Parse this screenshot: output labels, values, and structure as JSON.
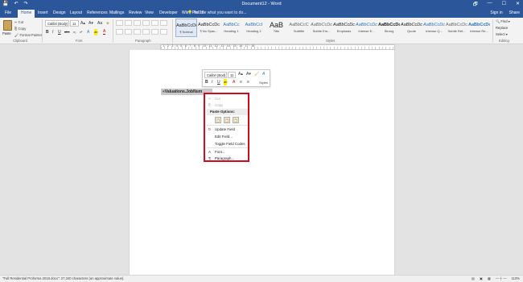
{
  "titlebar": {
    "title": "Document12 - Word",
    "qat": [
      "💾",
      "↶",
      "↷"
    ],
    "controls": [
      "🗗",
      "—",
      "☐",
      "✕"
    ]
  },
  "tabs": {
    "items": [
      "File",
      "Home",
      "Insert",
      "Design",
      "Layout",
      "References",
      "Mailings",
      "Review",
      "View",
      "Developer",
      "Wiiro Pro 10"
    ],
    "active": "Home",
    "tell_me": "💡 Tell me what you want to do...",
    "sign_in": "Sign in",
    "share": "Share"
  },
  "ribbon": {
    "clipboard": {
      "paste": "Paste",
      "cut": "✂ Cut",
      "copy": "⎘ Copy",
      "format_painter": "🖌 Format Painter",
      "label": "Clipboard"
    },
    "font": {
      "name": "Calibri (Body)",
      "size": "11",
      "label": "Font",
      "buttons": [
        "B",
        "I",
        "U",
        "abc",
        "x₂",
        "x²",
        "A",
        "ab",
        "A"
      ]
    },
    "paragraph": {
      "label": "Paragraph"
    },
    "styles": {
      "label": "Styles",
      "items": [
        {
          "preview": "AaBbCcDc",
          "name": "¶ Normal"
        },
        {
          "preview": "AaBbCcDc",
          "name": "¶ No Spac..."
        },
        {
          "preview": "AaBbCc",
          "name": "Heading 1"
        },
        {
          "preview": "AaBbCcI",
          "name": "Heading 2"
        },
        {
          "preview": "AaB",
          "name": "Title"
        },
        {
          "preview": "AaBbCcC",
          "name": "Subtitle"
        },
        {
          "preview": "AaBbCcDc",
          "name": "Subtle Em..."
        },
        {
          "preview": "AaBbCcDc",
          "name": "Emphasis"
        },
        {
          "preview": "AaBbCcDc",
          "name": "Intense E..."
        },
        {
          "preview": "AaBbCcDc",
          "name": "Strong"
        },
        {
          "preview": "AaBbCcDc",
          "name": "Quote"
        },
        {
          "preview": "AaBbCcDc",
          "name": "Intense Q..."
        },
        {
          "preview": "AaBbCcDc",
          "name": "Subtle Ref..."
        },
        {
          "preview": "AaBbCcDc",
          "name": "Intense Re..."
        }
      ]
    },
    "editing": {
      "find": "🔍 Find ▾",
      "replace": "Replace",
      "select": "Select ▾",
      "label": "Editing"
    }
  },
  "ruler": {
    "numbers": "· 1 · 2 · 3 · 4 · 5 · 6 · 7 · 8 · 9 · 10 · 11 · 12 · 13 · 14 · 15 · 16 · 17 · 18"
  },
  "document": {
    "field_text": "«Valuations.JobNum"
  },
  "mini_toolbar": {
    "font": "Calibri (Bod)",
    "size": "11",
    "row2": [
      "B",
      "I",
      "U",
      "ab",
      "A",
      "≡",
      "≡",
      "Styles"
    ],
    "styles_label": "Styles"
  },
  "context_menu": {
    "items": [
      {
        "label": "Cut",
        "icon": "✂",
        "disabled": true
      },
      {
        "label": "Copy",
        "icon": "⎘",
        "disabled": true
      },
      {
        "label": "Update Field",
        "icon": "↻",
        "disabled": false
      },
      {
        "label": "Edit Field...",
        "icon": "",
        "disabled": false
      },
      {
        "label": "Toggle Field Codes",
        "icon": "",
        "disabled": false
      },
      {
        "label": "Font...",
        "icon": "A",
        "disabled": false
      },
      {
        "label": "Paragraph...",
        "icon": "¶",
        "disabled": false
      }
    ],
    "paste_header": "Paste Options:",
    "paste_icons": [
      "📋",
      "📋",
      "📋"
    ]
  },
  "status": {
    "left": "\"Full Residential Proforma 2016.docx\": 27,340 characters (an approximate value).",
    "zoom": "110%"
  }
}
